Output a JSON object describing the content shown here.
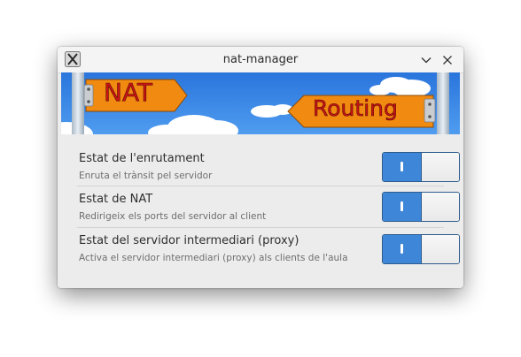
{
  "window": {
    "title": "nat-manager"
  },
  "banner": {
    "left_sign": "NAT",
    "right_sign": "Routing"
  },
  "settings": [
    {
      "title": "Estat de l'enrutament",
      "description": "Enruta el trànsit pel servidor",
      "enabled": true
    },
    {
      "title": "Estat de NAT",
      "description": "Redirigeix els ports del servidor al client",
      "enabled": true
    },
    {
      "title": "Estat del servidor intermediari (proxy)",
      "description": "Activa el servidor intermediari (proxy) als clients de l'aula",
      "enabled": true
    }
  ],
  "colors": {
    "accent": "#3d86d8",
    "sign_orange": "#f08a10",
    "sign_text": "#c81414",
    "sky": "#2f7fe0"
  }
}
